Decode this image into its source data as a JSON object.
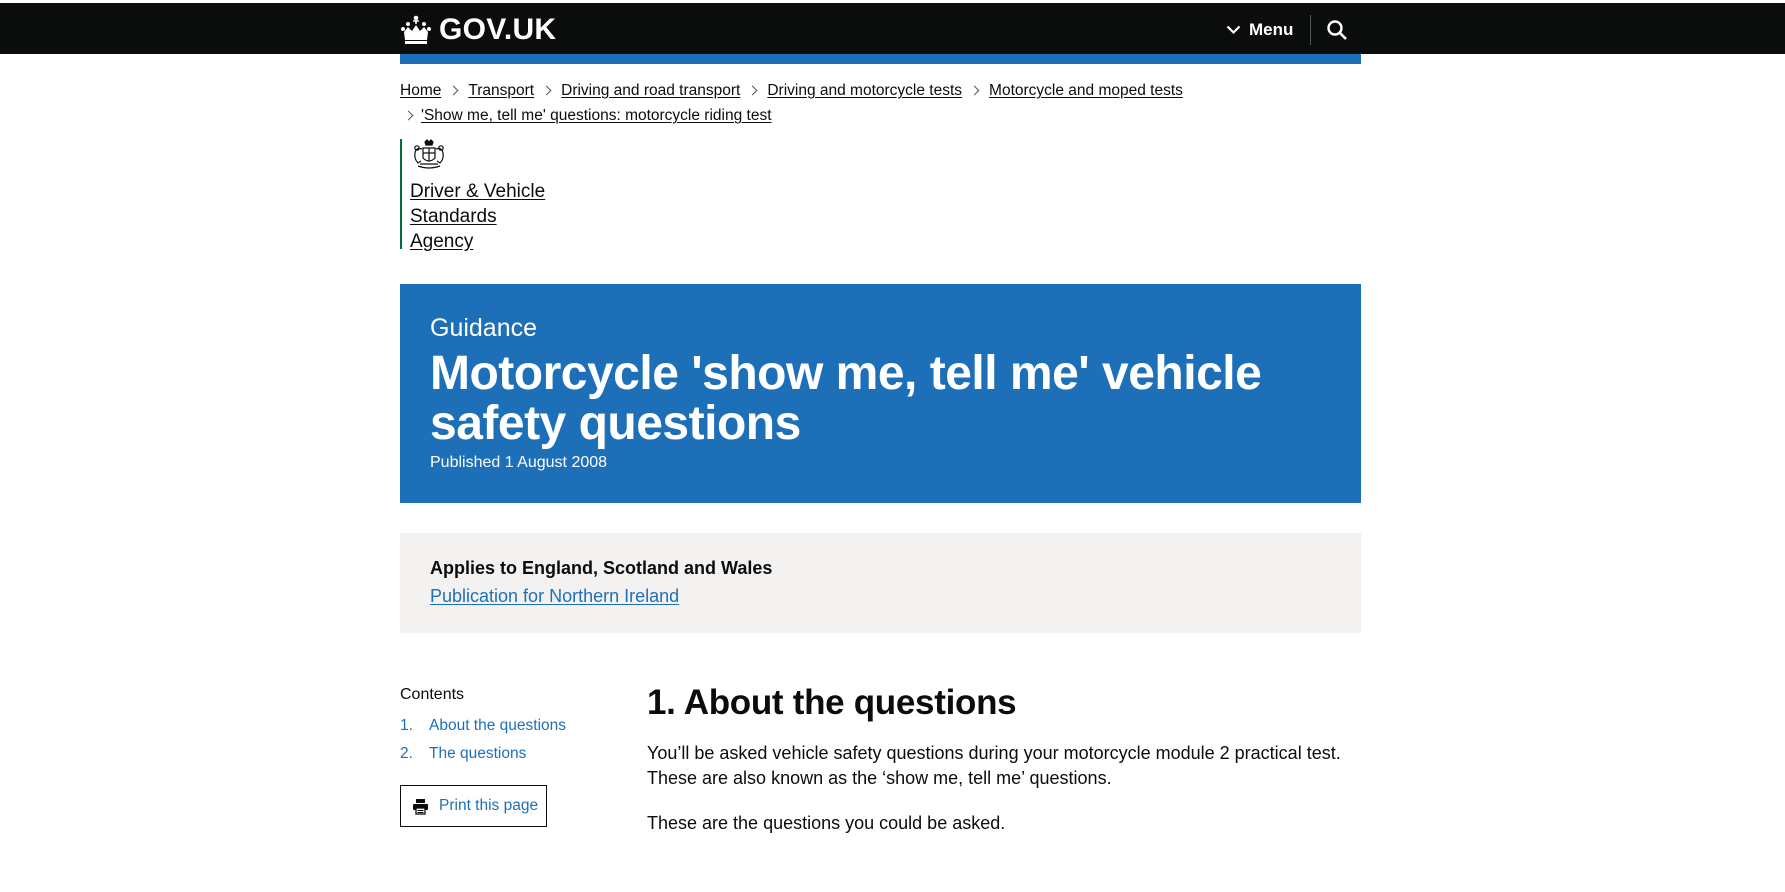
{
  "header": {
    "logo_text": "GOV.UK",
    "menu_label": "Menu"
  },
  "breadcrumbs": [
    {
      "label": "Home"
    },
    {
      "label": "Transport"
    },
    {
      "label": "Driving and road transport"
    },
    {
      "label": "Driving and motorcycle tests"
    },
    {
      "label": "Motorcycle and moped tests"
    },
    {
      "label": "'Show me, tell me' questions: motorcycle riding test"
    }
  ],
  "organisation": {
    "name_line1": "Driver & Vehicle",
    "name_line2": "Standards",
    "name_line3": "Agency"
  },
  "title_banner": {
    "doc_type": "Guidance",
    "title_line1": "Motorcycle 'show me, tell me' vehicle",
    "title_line2": "safety questions",
    "published": "Published 1 August 2008"
  },
  "applies": {
    "text": "Applies to England, Scotland and Wales",
    "link": "Publication for Northern Ireland"
  },
  "contents": {
    "title": "Contents",
    "items": [
      {
        "num": "1.",
        "label": "About the questions"
      },
      {
        "num": "2.",
        "label": "The questions"
      }
    ],
    "print_label": "Print this page"
  },
  "main": {
    "heading": "1. About the questions",
    "para1_line1": "You’ll be asked vehicle safety questions during your motorcycle module 2 practical test.",
    "para1_line2": "These are also known as the ‘show me, tell me’ questions.",
    "para2": "These are the questions you could be asked."
  },
  "colors": {
    "header_bg": "#0b0c0c",
    "brand_blue": "#1d70b8",
    "org_green": "#00703c",
    "panel_grey": "#f3f2f1",
    "text": "#0b0c0c"
  }
}
